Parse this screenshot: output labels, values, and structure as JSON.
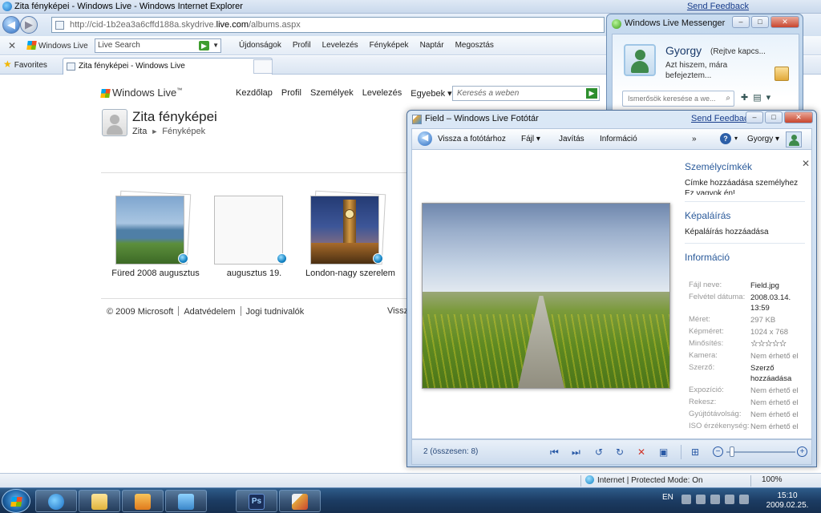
{
  "ie": {
    "title": "Zita fényképei - Windows Live - Windows Internet Explorer",
    "send_feedback": "Send Feedback",
    "address": "http://cid-1b2ea3a6cffd188a.skydrive.",
    "address_domain": "live.com",
    "address_tail": "/albums.aspx",
    "toolbar": {
      "close": "✕",
      "brand": "Windows Live",
      "search_placeholder": "Live Search",
      "links": [
        "Újdonságok",
        "Profil",
        "Levelezés",
        "Fényképek",
        "Naptár",
        "Megosztás"
      ]
    },
    "favorites_label": "Favorites",
    "tab_title": "Zita fényképei - Windows Live",
    "status": {
      "zone": "Internet | Protected Mode: On",
      "zoom": "100%"
    }
  },
  "page": {
    "logo": "Windows Live",
    "logo_tm": "™",
    "nav": [
      "Kezdőlap",
      "Profil",
      "Személyek",
      "Levelezés",
      "Egyebek ▾"
    ],
    "search_placeholder": "Keresés a weben",
    "title": "Zita fényképei",
    "breadcrumb": [
      "Zita",
      "Fényképek"
    ],
    "breadcrumb_sep": "►",
    "albums": [
      {
        "caption": "Füred 2008 augusztus"
      },
      {
        "caption": "augusztus 19."
      },
      {
        "caption": "London-nagy szerelem"
      }
    ],
    "footer": {
      "copyright": "© 2009 Microsoft",
      "privacy": "Adatvédelem",
      "legal": "Jogi tudnivalók",
      "right": "Vissz"
    }
  },
  "messenger": {
    "title": "Windows Live Messenger",
    "name": "Gyorgy",
    "status": "(Rejtve kapcs...",
    "message": "Azt hiszem, mára befejeztem...",
    "search_placeholder": "Ismerősök keresése a we..."
  },
  "gallery": {
    "title": "Field – Windows Live Fotótár",
    "send_feedback": "Send Feedback",
    "toolbar": {
      "back": "Vissza a fotótárhoz",
      "file": "Fájl ▾",
      "fix": "Javítás",
      "info": "Információ",
      "more": "»",
      "user": "Gyorgy ▾"
    },
    "tags_heading": "Személycímkék",
    "tags_add": "Címke hozzáadása személyhez",
    "tags_me": "Ez vagyok én!",
    "caption_heading": "Képaláírás",
    "caption_add": "Képaláírás hozzáadása",
    "info_heading": "Információ",
    "info": [
      {
        "label": "Fájl neve:",
        "value": "Field.jpg"
      },
      {
        "label": "Felvétel dátuma:",
        "value": "2008.03.14. 13:59"
      },
      {
        "label": "Méret:",
        "value": "297 KB"
      },
      {
        "label": "Képméret:",
        "value": "1024 x 768"
      },
      {
        "label": "Minősítés:",
        "value": "☆☆☆☆☆"
      },
      {
        "label": "Kamera:",
        "value": "Nem érhető el"
      },
      {
        "label": "Szerző:",
        "value": "Szerző hozzáadása"
      },
      {
        "label": "Expozíció:",
        "value": "Nem érhető el"
      },
      {
        "label": "Rekesz:",
        "value": "Nem érhető el"
      },
      {
        "label": "Gyújtótávolság:",
        "value": "Nem érhető el"
      },
      {
        "label": "ISO érzékenység:",
        "value": "Nem érhető el"
      }
    ],
    "count": "2 (összesen: 8)"
  },
  "taskbar": {
    "lang": "EN",
    "time": "15:10",
    "date": "2009.02.25."
  },
  "colors": {
    "accent": "#2a5a9a",
    "link": "#1a3e8c",
    "taskbar": "#1c3c63"
  }
}
